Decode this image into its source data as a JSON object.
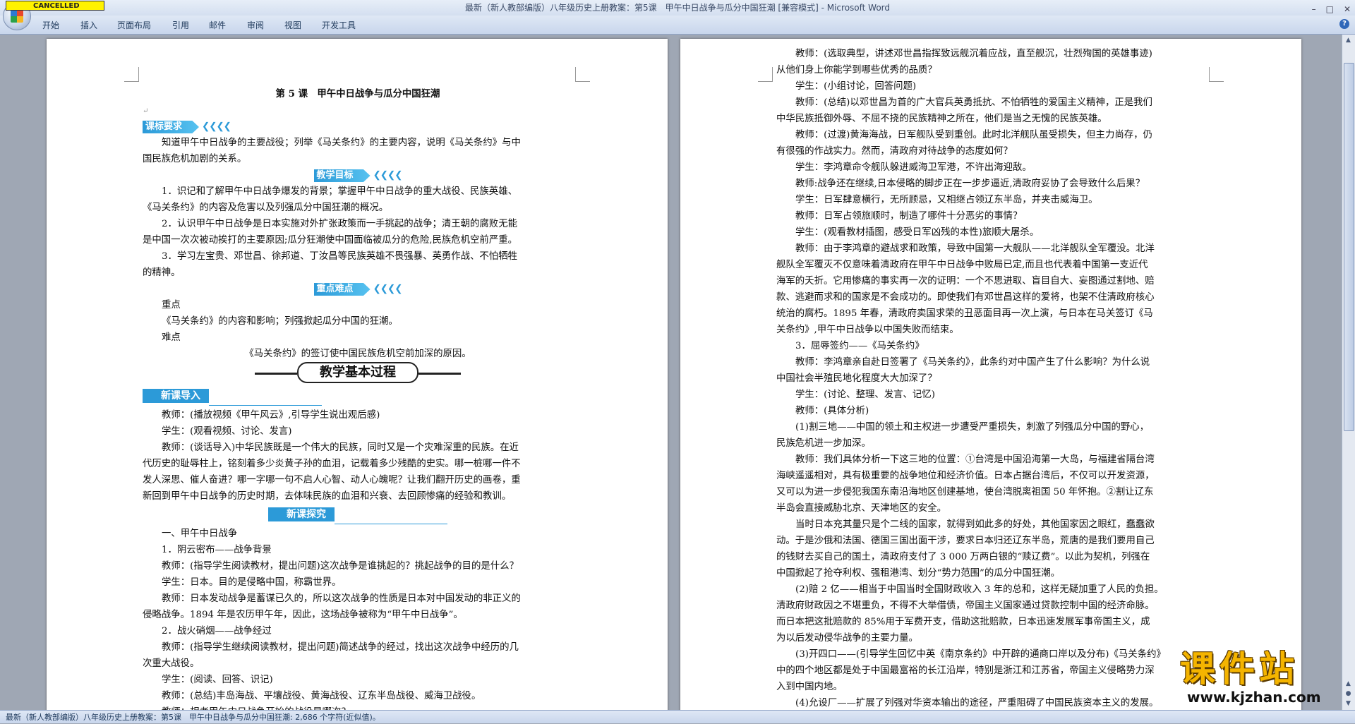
{
  "window": {
    "title": "最新（新人教部编版）八年级历史上册教案：第5课　甲午中日战争与瓜分中国狂潮 [兼容模式] - Microsoft Word",
    "cancelled_label": "CANCELLED",
    "controls": [
      "–",
      "□",
      "✕"
    ]
  },
  "ribbon": {
    "tabs": [
      "开始",
      "插入",
      "页面布局",
      "引用",
      "邮件",
      "审阅",
      "视图",
      "开发工具"
    ],
    "help": "?"
  },
  "left_page": {
    "title": "第 5 课　甲午中日战争与瓜分中国狂潮",
    "sec1_badge": "课标要求",
    "sec1_text": [
      "知道甲午中日战争的主要战役；列举《马关条约》的主要内容，说明《马关条约》与中",
      "国民族危机加剧的关系。"
    ],
    "sec2_badge": "教学目标",
    "sec2_text": [
      "1．识记和了解甲午中日战争爆发的背景；掌握甲午中日战争的重大战役、民族英雄、",
      "《马关条约》的内容及危害以及列强瓜分中国狂潮的概况。",
      "2．认识甲午中日战争是日本实施对外扩张政策而一手挑起的战争；清王朝的腐败无能",
      "是中国一次次被动挨打的主要原因;瓜分狂潮使中国面临被瓜分的危险,民族危机空前严重。",
      "3．学习左宝贵、邓世昌、徐邦道、丁汝昌等民族英雄不畏强暴、英勇作战、不怕牺牲",
      "的精神。"
    ],
    "sec3_badge": "重点难点",
    "sec3_text": [
      "重点",
      "《马关条约》的内容和影响；列强掀起瓜分中国的狂潮。",
      "难点"
    ],
    "sec3_center": "《马关条约》的签订使中国民族危机空前加深的原因。",
    "banner": "教学基本过程",
    "intro_badge": "新课导入",
    "intro_text": [
      "教师：(播放视频《甲午风云》,引导学生说出观后感)",
      "学生：(观看视频、讨论、发言)",
      "教师：(谈话导入)中华民族既是一个伟大的民族，同时又是一个灾难深重的民族。在近",
      "代历史的耻辱柱上，铭刻着多少炎黄子孙的血泪，记载着多少残酷的史实。哪一桩哪一件不",
      "发人深思、催人奋进？哪一字哪一句不启人心智、动人心魄呢？让我们翻开历史的画卷，重",
      "新回到甲午中日战争的历史时期，去体味民族的血泪和兴衰、去回顾惨痛的经验和教训。"
    ],
    "explore_badge": "新课探究",
    "explore_text": [
      "一、甲午中日战争",
      "1．阴云密布——战争背景",
      "教师：(指导学生阅读教材，提出问题)这次战争是谁挑起的？挑起战争的目的是什么？",
      "学生：日本。目的是侵略中国，称霸世界。",
      "教师：日本发动战争是蓄谋已久的，所以这次战争的性质是日本对中国发动的非正义的",
      "侵略战争。1894 年是农历甲午年，因此，这场战争被称为“甲午中日战争”。",
      "2．战火硝烟——战争经过",
      "教师：(指导学生继续阅读教材，提出问题)简述战争的经过，找出这次战争中经历的几",
      "次重大战役。",
      "学生：(阅读、回答、识记)",
      "教师：(总结)丰岛海战、平壤战役、黄海战役、辽东半岛战役、威海卫战役。",
      "教师：相考甲午中日战争开始的战役是哪次？"
    ]
  },
  "right_page": {
    "lines": [
      {
        "t": "教师：(选取典型，讲述邓世昌指挥致远舰沉着应战，直至舰沉，壮烈殉国的英雄事迹)",
        "i": true
      },
      {
        "t": "从他们身上你能学到哪些优秀的品质？",
        "i": false
      },
      {
        "t": "学生：(小组讨论，回答问题)",
        "i": true
      },
      {
        "t": "教师：(总结)以邓世昌为首的广大官兵英勇抵抗、不怕牺牲的爱国主义精神，正是我们",
        "i": true
      },
      {
        "t": "中华民族抵御外辱、不屈不挠的民族精神之所在，他们是当之无愧的民族英雄。",
        "i": false
      },
      {
        "t": "教师：(过渡)黄海海战，日军舰队受到重创。此时北洋舰队虽受损失，但主力尚存，仍",
        "i": true
      },
      {
        "t": "有很强的作战实力。然而，清政府对待战争的态度如何？",
        "i": false
      },
      {
        "t": "学生：李鸿章命令舰队躲进威海卫军港，不许出海迎敌。",
        "i": true
      },
      {
        "t": "教师:战争还在继续,日本侵略的脚步正在一步步逼近,清政府妥协了会导致什么后果？",
        "i": true
      },
      {
        "t": "学生：日军肆意横行，无所顾忌，又相继占领辽东半岛，并夹击威海卫。",
        "i": true
      },
      {
        "t": "教师：日军占领旅顺时，制造了哪件十分恶劣的事情？",
        "i": true
      },
      {
        "t": "学生：(观看教材插图，感受日军凶残的本性)旅顺大屠杀。",
        "i": true
      },
      {
        "t": "教师：由于李鸿章的避战求和政策，导致中国第一大舰队——北洋舰队全军覆没。北洋",
        "i": true
      },
      {
        "t": "舰队全军覆灭不仅意味着清政府在甲午中日战争中败局已定,而且也代表着中国第一支近代",
        "i": false
      },
      {
        "t": "海军的夭折。它用惨痛的事实再一次的证明：一个不思进取、盲目自大、妄图通过割地、赔",
        "i": false
      },
      {
        "t": "款、逃避而求和的国家是不会成功的。即使我们有邓世昌这样的爱将，也架不住清政府核心",
        "i": false
      },
      {
        "t": "统治的腐朽。1895 年春，清政府卖国求荣的丑恶面目再一次上演，与日本在马关签订《马",
        "i": false
      },
      {
        "t": "关条约》,甲午中日战争以中国失败而结束。",
        "i": false
      },
      {
        "t": "3．屈辱签约——《马关条约》",
        "i": true
      },
      {
        "t": "教师：李鸿章亲自赴日签署了《马关条约》，此条约对中国产生了什么影响？为什么说",
        "i": true
      },
      {
        "t": "中国社会半殖民地化程度大大加深了？",
        "i": false
      },
      {
        "t": "学生：(讨论、整理、发言、记忆)",
        "i": true
      },
      {
        "t": "教师：(具体分析)",
        "i": true
      },
      {
        "t": "(1)割三地——中国的领土和主权进一步遭受严重损失，刺激了列强瓜分中国的野心，",
        "i": true
      },
      {
        "t": "民族危机进一步加深。",
        "i": false
      },
      {
        "t": "教师：我们具体分析一下这三地的位置：①台湾是中国沿海第一大岛，与福建省隔台湾",
        "i": true
      },
      {
        "t": "海峡遥遥相对，具有极重要的战争地位和经济价值。日本占据台湾后，不仅可以开发资源，",
        "i": false
      },
      {
        "t": "又可以为进一步侵犯我国东南沿海地区创建基地，使台湾脱离祖国 50 年怀抱。②割让辽东",
        "i": false
      },
      {
        "t": "半岛会直接威胁北京、天津地区的安全。",
        "i": false
      },
      {
        "t": "当时日本充其量只是个二线的国家，就得到如此多的好处，其他国家因之眼红，蠢蠢欲",
        "i": true
      },
      {
        "t": "动。于是沙俄和法国、德国三国出面干涉，要求日本归还辽东半岛，荒唐的是我们要用自己",
        "i": false
      },
      {
        "t": "的钱财去买自己的国土，清政府支付了 3 000 万两白银的“赎辽费”。以此为契机，列强在",
        "i": false
      },
      {
        "t": "中国掀起了抢夺利权、强租港湾、划分“势力范围”的瓜分中国狂潮。",
        "i": false
      },
      {
        "t": "(2)赔 2 亿——相当于中国当时全国财政收入 3 年的总和，这样无疑加重了人民的负担。",
        "i": true
      },
      {
        "t": "清政府财政因之不堪重负，不得不大举借债，帝国主义国家通过贷款控制中国的经济命脉。",
        "i": false
      },
      {
        "t": "而日本把这批赔款的 85%用于军费开支，借助这批赔款，日本迅速发展军事帝国主义，成",
        "i": false
      },
      {
        "t": "为以后发动侵华战争的主要力量。",
        "i": false
      },
      {
        "t": "(3)开四口——(引导学生回忆中英《南京条约》中开辟的通商口岸以及分布)《马关条约》",
        "i": true
      },
      {
        "t": "中的四个地区都是处于中国最富裕的长江沿岸，特别是浙江和江苏省，帝国主义侵略势力深",
        "i": false
      },
      {
        "t": "入到中国内地。",
        "i": false
      },
      {
        "t": "(4)允设厂——扩展了列强对华资本输出的途径，严重阻碍了中国民族资本主义的发展。",
        "i": true
      }
    ]
  },
  "statusbar": {
    "text": "最新（新人教部编版）八年级历史上册教案：第5课　甲午中日战争与瓜分中国狂潮: 2,686 个字符(近似值)。"
  },
  "watermark": {
    "big": "课件站",
    "url": "www.kjzhan.com"
  },
  "colors": {
    "accent": "#2c9ad8",
    "watermark": "#f4b400"
  }
}
